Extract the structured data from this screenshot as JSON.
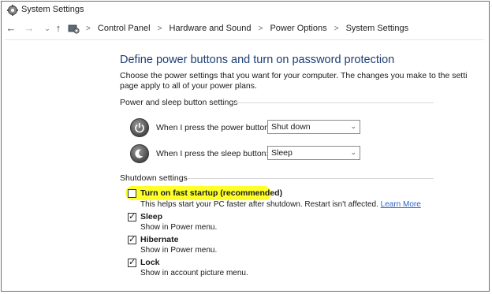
{
  "window": {
    "title": "System Settings"
  },
  "nav": {
    "back_icon": "arrow-left-icon",
    "forward_icon": "arrow-right-icon",
    "recent_icon": "chevron-down-icon",
    "up_icon": "arrow-up-icon",
    "breadcrumbs": [
      "Control Panel",
      "Hardware and Sound",
      "Power Options",
      "System Settings"
    ],
    "separator": ">"
  },
  "main": {
    "heading": "Define power buttons and turn on password protection",
    "description_line1": "Choose the power settings that you want for your computer. The changes you make to the setti",
    "description_line2": "page apply to all of your power plans."
  },
  "power_section": {
    "title": "Power and sleep button settings",
    "rows": [
      {
        "label": "When I press the power button:",
        "value": "Shut down",
        "icon": "power-icon"
      },
      {
        "label": "When I press the sleep button:",
        "value": "Sleep",
        "icon": "sleep-icon"
      }
    ]
  },
  "shutdown_section": {
    "title": "Shutdown settings",
    "options": [
      {
        "label": "Turn on fast startup (recommended)",
        "checked": false,
        "highlighted": true,
        "description": "This helps start your PC faster after shutdown. Restart isn't affected.",
        "link": "Learn More"
      },
      {
        "label": "Sleep",
        "checked": true,
        "description": "Show in Power menu."
      },
      {
        "label": "Hibernate",
        "checked": true,
        "description": "Show in Power menu."
      },
      {
        "label": "Lock",
        "checked": true,
        "description": "Show in account picture menu."
      }
    ]
  },
  "colors": {
    "heading": "#1e3f73",
    "link": "#2a64c5",
    "highlight": "#ffff2a"
  }
}
